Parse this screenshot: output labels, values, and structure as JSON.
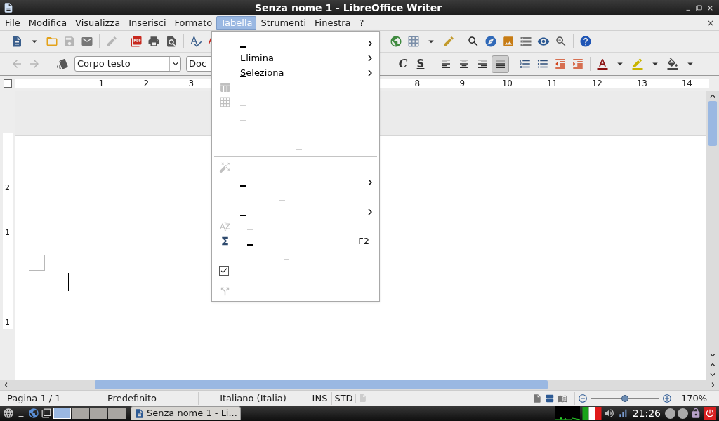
{
  "window": {
    "title": "Senza nome 1 - LibreOffice Writer"
  },
  "menubar": [
    {
      "label": "File",
      "selected": false
    },
    {
      "label": "Modifica",
      "selected": false
    },
    {
      "label": "Visualizza",
      "selected": false
    },
    {
      "label": "Inserisci",
      "selected": false
    },
    {
      "label": "Formato",
      "selected": false
    },
    {
      "label": "Tabella",
      "selected": true
    },
    {
      "label": "Strumenti",
      "selected": false
    },
    {
      "label": "Finestra",
      "selected": false
    },
    {
      "label": "?",
      "selected": false
    }
  ],
  "formatting": {
    "paragraph_style": "Corpo testo",
    "font_name": "Doc",
    "italic": "C",
    "underline": "S",
    "align": [
      {
        "selected": false
      },
      {
        "selected": false
      },
      {
        "selected": false
      },
      {
        "selected": true
      }
    ]
  },
  "ruler": {
    "numbers": [
      "1",
      "2",
      "3",
      "8",
      "9",
      "10",
      "11",
      "12",
      "13",
      "14"
    ],
    "vertical_numbers": [
      "2",
      "1",
      "1"
    ]
  },
  "menu": {
    "items": [
      {
        "kind": "blank",
        "disabled": false,
        "submenu": true
      },
      {
        "kind": "text",
        "label": "Elimina",
        "disabled": false,
        "submenu": true
      },
      {
        "kind": "text",
        "label": "Seleziona",
        "disabled": false,
        "submenu": true
      },
      {
        "kind": "blank",
        "disabled": true,
        "submenu": false
      },
      {
        "kind": "blank",
        "disabled": true,
        "submenu": false
      },
      {
        "kind": "blank",
        "disabled": true,
        "submenu": false
      },
      {
        "kind": "blank",
        "disabled": true,
        "submenu": false
      },
      {
        "kind": "blank",
        "disabled": true,
        "submenu": false
      },
      {
        "kind": "separator"
      },
      {
        "kind": "blank",
        "disabled": true,
        "submenu": false
      },
      {
        "kind": "blank",
        "disabled": false,
        "submenu": true
      },
      {
        "kind": "blank",
        "disabled": true,
        "submenu": false
      },
      {
        "kind": "blank",
        "disabled": false,
        "submenu": true
      },
      {
        "kind": "blank",
        "disabled": true,
        "submenu": false
      },
      {
        "kind": "blank",
        "disabled": false,
        "submenu": false,
        "shortcut": "F2"
      },
      {
        "kind": "blank",
        "disabled": true,
        "submenu": false
      },
      {
        "kind": "check",
        "checked": true,
        "disabled": false,
        "submenu": false
      },
      {
        "kind": "separator"
      },
      {
        "kind": "blank",
        "disabled": true,
        "submenu": false
      }
    ]
  },
  "status_bar": {
    "page": "Pagina 1 / 1",
    "page_style": "Predefinito",
    "language": "Italiano (Italia)",
    "insert_mode": "INS",
    "selection_mode": "STD",
    "zoom": "170%",
    "zoom_slider": {
      "level": 0.5
    }
  },
  "taskbar": {
    "workspaces": [
      {
        "selected": true
      },
      {
        "selected": false
      },
      {
        "selected": false
      },
      {
        "selected": false
      }
    ],
    "window_button": "Senza nome 1 - Li...",
    "clock": "21:26"
  }
}
